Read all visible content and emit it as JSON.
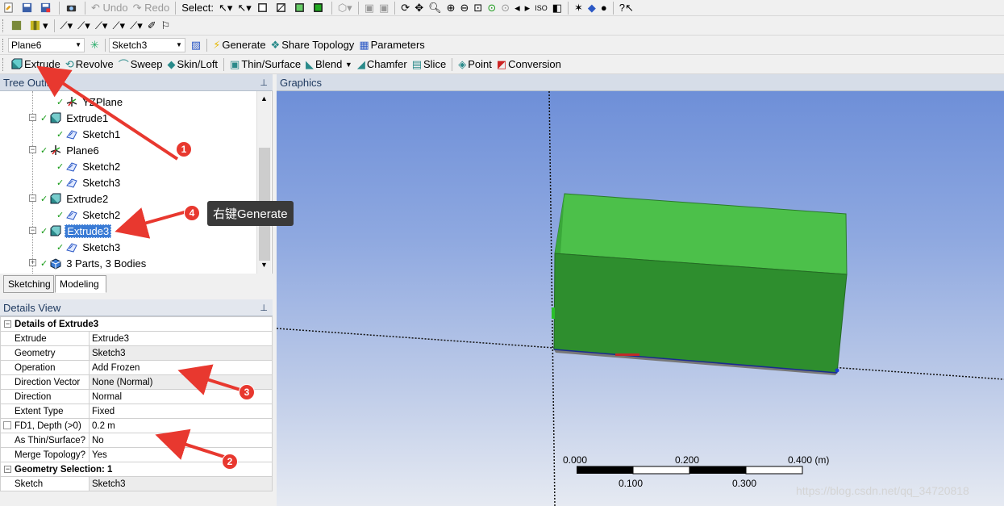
{
  "toolbar1": {
    "undo_label": "Undo",
    "redo_label": "Redo",
    "select_label": "Select:"
  },
  "toolbar3": {
    "plane_combo": "Plane6",
    "sketch_combo": "Sketch3",
    "generate_label": "Generate",
    "share_topology_label": "Share Topology",
    "parameters_label": "Parameters"
  },
  "toolbar4": {
    "extrude_label": "Extrude",
    "revolve_label": "Revolve",
    "sweep_label": "Sweep",
    "skin_loft_label": "Skin/Loft",
    "thin_surface_label": "Thin/Surface",
    "blend_label": "Blend",
    "chamfer_label": "Chamfer",
    "slice_label": "Slice",
    "point_label": "Point",
    "conversion_label": "Conversion"
  },
  "tree": {
    "header": "Tree Outline",
    "items": [
      {
        "label": "YZPlane",
        "icon": "plane-icon",
        "level": 3
      },
      {
        "label": "Extrude1",
        "icon": "extrude-icon",
        "level": 2
      },
      {
        "label": "Sketch1",
        "icon": "sketch-icon",
        "level": 3
      },
      {
        "label": "Plane6",
        "icon": "plane-icon",
        "level": 2
      },
      {
        "label": "Sketch2",
        "icon": "sketch-icon",
        "level": 3
      },
      {
        "label": "Sketch3",
        "icon": "sketch-icon",
        "level": 3
      },
      {
        "label": "Extrude2",
        "icon": "extrude-icon",
        "level": 2
      },
      {
        "label": "Sketch2",
        "icon": "sketch-icon",
        "level": 3
      },
      {
        "label": "Extrude3",
        "icon": "extrude-icon",
        "level": 2,
        "selected": true
      },
      {
        "label": "Sketch3",
        "icon": "sketch-icon",
        "level": 3
      },
      {
        "label": "3 Parts, 3 Bodies",
        "icon": "parts-icon",
        "level": 2
      }
    ],
    "tab_sketching": "Sketching",
    "tab_modeling": "Modeling"
  },
  "details": {
    "header": "Details View",
    "group1": "Details of Extrude3",
    "rows": [
      {
        "key": "Extrude",
        "value": "Extrude3"
      },
      {
        "key": "Geometry",
        "value": "Sketch3"
      },
      {
        "key": "Operation",
        "value": "Add Frozen"
      },
      {
        "key": "Direction Vector",
        "value": "None (Normal)"
      },
      {
        "key": "Direction",
        "value": "Normal"
      },
      {
        "key": "Extent Type",
        "value": "Fixed"
      },
      {
        "key": "FD1, Depth (>0)",
        "value": "0.2 m"
      },
      {
        "key": "As Thin/Surface?",
        "value": "No"
      },
      {
        "key": "Merge Topology?",
        "value": "Yes"
      }
    ],
    "group2": "Geometry Selection: 1",
    "sketch_key": "Sketch",
    "sketch_value": "Sketch3"
  },
  "graphics": {
    "header": "Graphics",
    "scale_top": [
      "0.000",
      "0.200",
      "0.400 (m)"
    ],
    "scale_bottom": [
      "0.100",
      "0.300"
    ]
  },
  "annotations": {
    "c1": "1",
    "c2": "2",
    "c3": "3",
    "c4": "4",
    "tooltip": "右键Generate"
  },
  "watermark": "https://blog.csdn.net/qq_34720818",
  "colors": {
    "accent": "#3a7bd5",
    "callout": "#e8382f",
    "body_top": "#4cc04a",
    "body_front": "#2e8e2e"
  }
}
